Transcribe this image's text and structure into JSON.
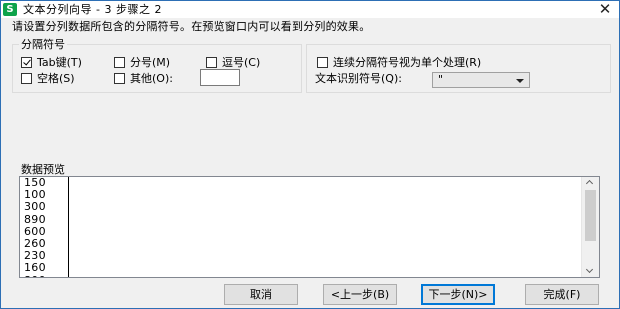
{
  "window": {
    "title": "文本分列向导 - 3 步骤之 2",
    "app_icon_letter": "S",
    "app_icon_color": "#0da34a",
    "close_glyph": "✕"
  },
  "instruction": "请设置分列数据所包含的分隔符号。在预览窗口内可以看到分列的效果。",
  "delimiters": {
    "legend": "分隔符号",
    "options": [
      {
        "label": "Tab键(T)",
        "checked": true
      },
      {
        "label": "分号(M)",
        "checked": false
      },
      {
        "label": "逗号(C)",
        "checked": false
      },
      {
        "label": "空格(S)",
        "checked": false
      },
      {
        "label": "其他(O):",
        "checked": false
      }
    ],
    "other_value": ""
  },
  "options": {
    "consecutive_label": "连续分隔符号视为单个处理(R)",
    "consecutive_checked": false,
    "text_qualifier_label": "文本识别符号(Q):",
    "text_qualifier_value": "\""
  },
  "preview": {
    "legend": "数据预览",
    "rows": [
      "150",
      "100",
      "300",
      "890",
      "600",
      "260",
      "230",
      "160",
      "800"
    ]
  },
  "buttons": {
    "cancel": "取消",
    "back": "<上一步(B)",
    "next": "下一步(N)>",
    "finish": "完成(F)"
  },
  "colors": {
    "window_border": "#2d6fb5",
    "default_button_border": "#0078d7"
  }
}
